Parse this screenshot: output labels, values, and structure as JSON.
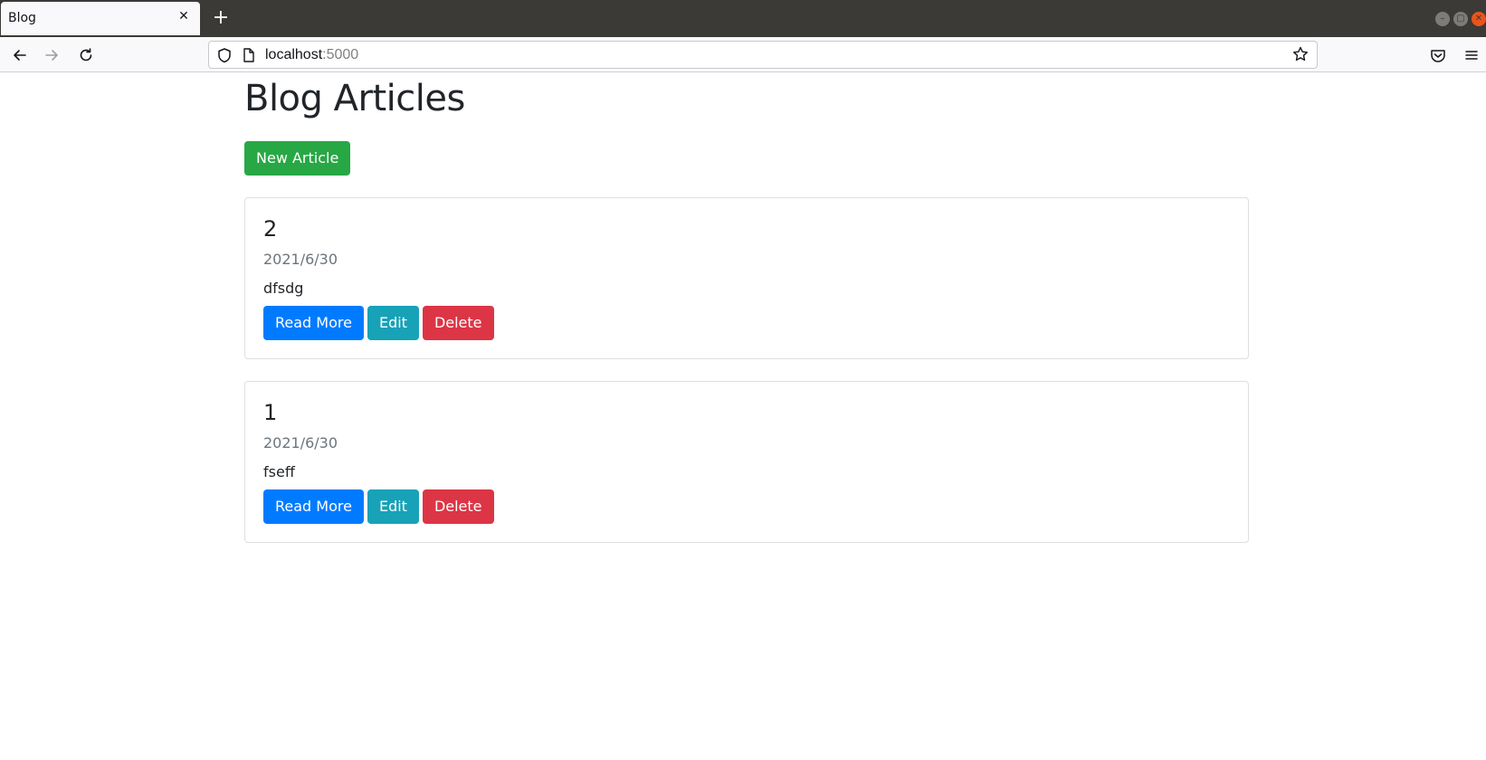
{
  "browser": {
    "tab_title": "Blog",
    "url_host": "localhost",
    "url_port": ":5000"
  },
  "page": {
    "title": "Blog Articles",
    "new_button": "New Article"
  },
  "articles": [
    {
      "title": "2",
      "date": "2021/6/30",
      "body": "dfsdg",
      "read_more": "Read More",
      "edit": "Edit",
      "delete": "Delete"
    },
    {
      "title": "1",
      "date": "2021/6/30",
      "body": "fseff",
      "read_more": "Read More",
      "edit": "Edit",
      "delete": "Delete"
    }
  ],
  "colors": {
    "success": "#28a745",
    "primary": "#007bff",
    "info": "#17a2b8",
    "danger": "#dc3545"
  }
}
